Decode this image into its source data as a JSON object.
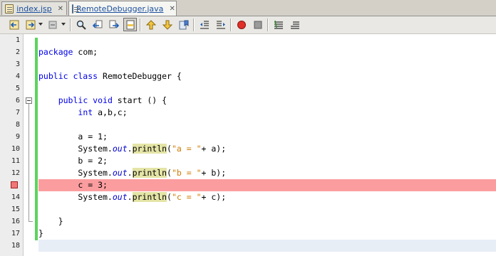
{
  "tabs": [
    {
      "label": "index.jsp",
      "close": "✕",
      "icon": "jsp-file-icon",
      "active": false
    },
    {
      "label": "RemoteDebugger.java",
      "close": "✕",
      "icon": "java-file-icon",
      "active": true
    }
  ],
  "toolbar": {
    "buttons": [
      "back-icon",
      "forward-icon",
      "last-edit-icon",
      "find-icon",
      "find-previous-icon",
      "find-next-icon",
      "toggle-highlight-icon",
      "previous-bookmark-icon",
      "next-bookmark-icon",
      "toggle-bookmark-icon",
      "shift-left-icon",
      "shift-right-icon",
      "start-macro-icon",
      "stop-macro-icon",
      "comment-icon",
      "uncomment-icon"
    ]
  },
  "editor": {
    "breakpoint_line": 13,
    "lines": [
      {
        "num": "1",
        "text": ""
      },
      {
        "num": "2",
        "text": "package com;"
      },
      {
        "num": "3",
        "text": ""
      },
      {
        "num": "4",
        "text": "public class RemoteDebugger {"
      },
      {
        "num": "5",
        "text": ""
      },
      {
        "num": "6",
        "text": "    public void start () {"
      },
      {
        "num": "7",
        "text": "        int a,b,c;"
      },
      {
        "num": "8",
        "text": ""
      },
      {
        "num": "9",
        "text": "        a = 1;"
      },
      {
        "num": "10",
        "text": "        System.out.println(\"a = \"+ a);"
      },
      {
        "num": "11",
        "text": "        b = 2;"
      },
      {
        "num": "12",
        "text": "        System.out.println(\"b = \"+ b);"
      },
      {
        "num": "13",
        "text": "        c = 3;"
      },
      {
        "num": "14",
        "text": "        System.out.println(\"c = \"+ c);"
      },
      {
        "num": "15",
        "text": ""
      },
      {
        "num": "16",
        "text": "    }"
      },
      {
        "num": "17",
        "text": "}"
      },
      {
        "num": "18",
        "text": ""
      }
    ]
  },
  "colors": {
    "keyword": "#0000e6",
    "string": "#ce7b00",
    "breakpoint_line": "#fb9d9f",
    "method_highlight": "#e4e4a6",
    "change_bar": "#5dd35d"
  }
}
